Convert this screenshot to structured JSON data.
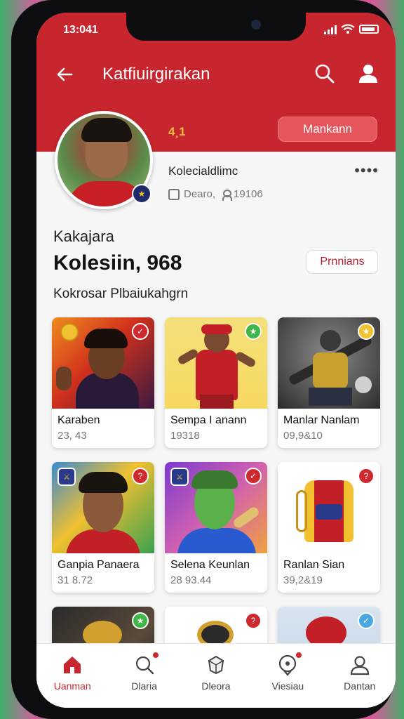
{
  "status": {
    "time": "13:041"
  },
  "header": {
    "title": "Katfiuirgirakan",
    "level_label": "4¸1",
    "follow_label": "Mankann"
  },
  "profile": {
    "username": "Kolecialdlimc",
    "stat_a": "Dearo,",
    "stat_b": "19106"
  },
  "section": {
    "kicker": "Kakajara",
    "title": "Kolesiin, 968",
    "filter_label": "Prnnians",
    "subtitle": "Kokrosar Plbaiukahgrn"
  },
  "cards": [
    {
      "name": "Karaben",
      "value": "23, 43"
    },
    {
      "name": "Sempa I anann",
      "value": "19318"
    },
    {
      "name": "Manlar Nanlam",
      "value": "09,9&10"
    },
    {
      "name": "Ganpia Panaera",
      "value": "31 8.72"
    },
    {
      "name": "Selena Keunlan",
      "value": "28 93.44"
    },
    {
      "name": "Ranlan Sian",
      "value": "39,2&19"
    }
  ],
  "nav": [
    {
      "label": "Uanman",
      "icon": "home-icon",
      "active": true
    },
    {
      "label": "Dlaria",
      "icon": "search-icon"
    },
    {
      "label": "Dleora",
      "icon": "gem-icon"
    },
    {
      "label": "Viesiau",
      "icon": "map-pin-icon"
    },
    {
      "label": "Dantan",
      "icon": "user-icon"
    }
  ],
  "colors": {
    "accent": "#c8262e",
    "background": "#f6f6f6",
    "card": "#ffffff"
  }
}
